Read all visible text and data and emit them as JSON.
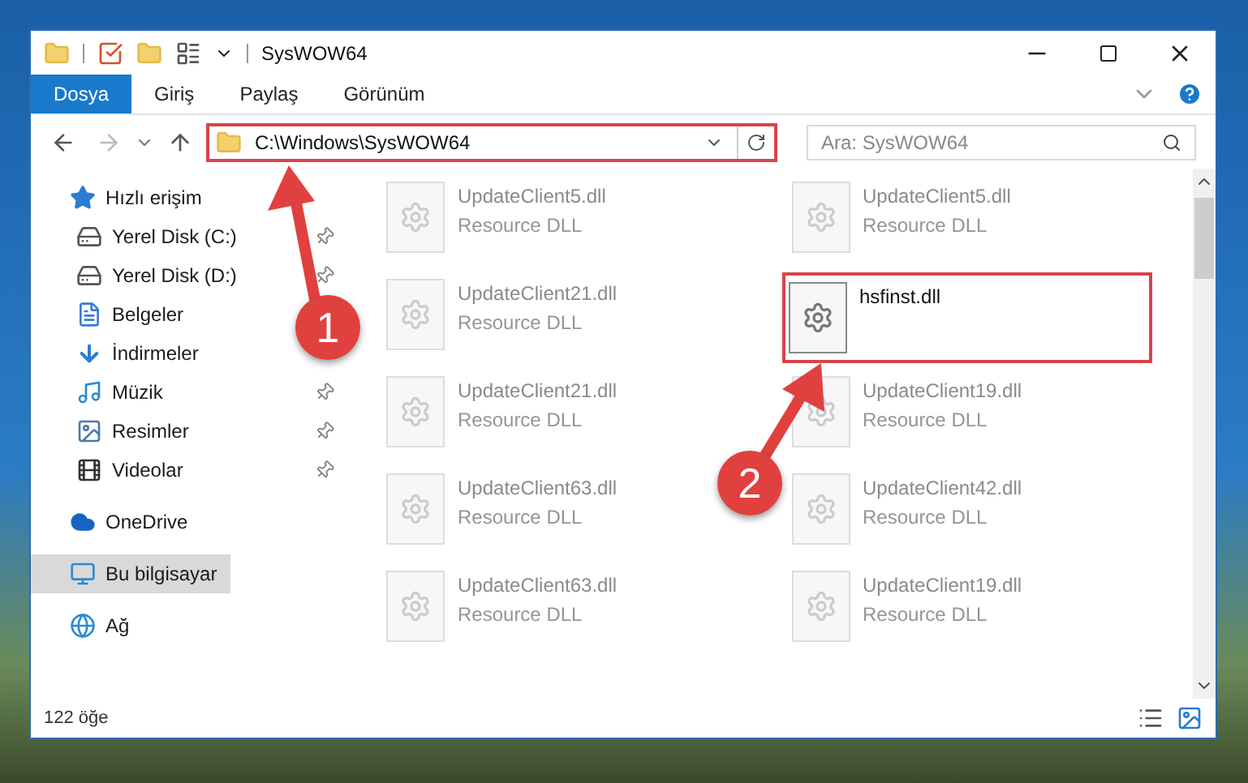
{
  "window": {
    "title": "SysWOW64"
  },
  "ribbon_tabs": [
    {
      "label": "Dosya",
      "kind": "file"
    },
    {
      "label": "Giriş",
      "kind": "tab"
    },
    {
      "label": "Paylaş",
      "kind": "tab"
    },
    {
      "label": "Görünüm",
      "kind": "tab"
    }
  ],
  "address_bar": {
    "path": "C:\\Windows\\SysWOW64",
    "highlighted": true
  },
  "search": {
    "placeholder": "Ara: SysWOW64"
  },
  "navigation": [
    {
      "label": "Hızlı erişim",
      "kind": "star",
      "selected": false,
      "children": [
        {
          "label": "Yerel Disk (C:)",
          "kind": "drive",
          "pinned": true,
          "selected": false
        },
        {
          "label": "Yerel Disk (D:)",
          "kind": "drive",
          "pinned": true,
          "selected": false
        },
        {
          "label": "Belgeler",
          "kind": "document",
          "pinned": false,
          "selected": false
        },
        {
          "label": "İndirmeler",
          "kind": "download",
          "pinned": false,
          "selected": false
        },
        {
          "label": "Müzik",
          "kind": "music",
          "pinned": true,
          "selected": false
        },
        {
          "label": "Resimler",
          "kind": "pictures",
          "pinned": true,
          "selected": false
        },
        {
          "label": "Videolar",
          "kind": "video",
          "pinned": true,
          "selected": false
        }
      ]
    },
    {
      "label": "OneDrive",
      "kind": "cloud",
      "selected": false
    },
    {
      "label": "Bu bilgisayar",
      "kind": "computer",
      "selected": true
    },
    {
      "label": "Ağ",
      "kind": "network",
      "selected": false
    }
  ],
  "files": [
    {
      "name": "UpdateClient5.dll",
      "type": "Resource DLL",
      "dimmed": true,
      "highlighted": false
    },
    {
      "name": "UpdateClient5.dll",
      "type": "Resource DLL",
      "dimmed": true,
      "highlighted": false
    },
    {
      "name": "UpdateClient21.dll",
      "type": "Resource DLL",
      "dimmed": true,
      "highlighted": false
    },
    {
      "name": "hsfinst.dll",
      "dimmed": false,
      "highlighted": true
    },
    {
      "name": "UpdateClient21.dll",
      "type": "Resource DLL",
      "dimmed": true,
      "highlighted": false
    },
    {
      "name": "UpdateClient19.dll",
      "type": "Resource DLL",
      "dimmed": true,
      "highlighted": false
    },
    {
      "name": "UpdateClient63.dll",
      "type": "Resource DLL",
      "dimmed": true,
      "highlighted": false
    },
    {
      "name": "UpdateClient42.dll",
      "type": "Resource DLL",
      "dimmed": true,
      "highlighted": false
    },
    {
      "name": "UpdateClient63.dll",
      "type": "Resource DLL",
      "dimmed": true,
      "highlighted": false
    },
    {
      "name": "UpdateClient19.dll",
      "type": "Resource DLL",
      "dimmed": true,
      "highlighted": false
    }
  ],
  "status_bar": {
    "item_count": "122 öğe"
  },
  "annotations": [
    {
      "number": "1"
    },
    {
      "number": "2"
    }
  ]
}
